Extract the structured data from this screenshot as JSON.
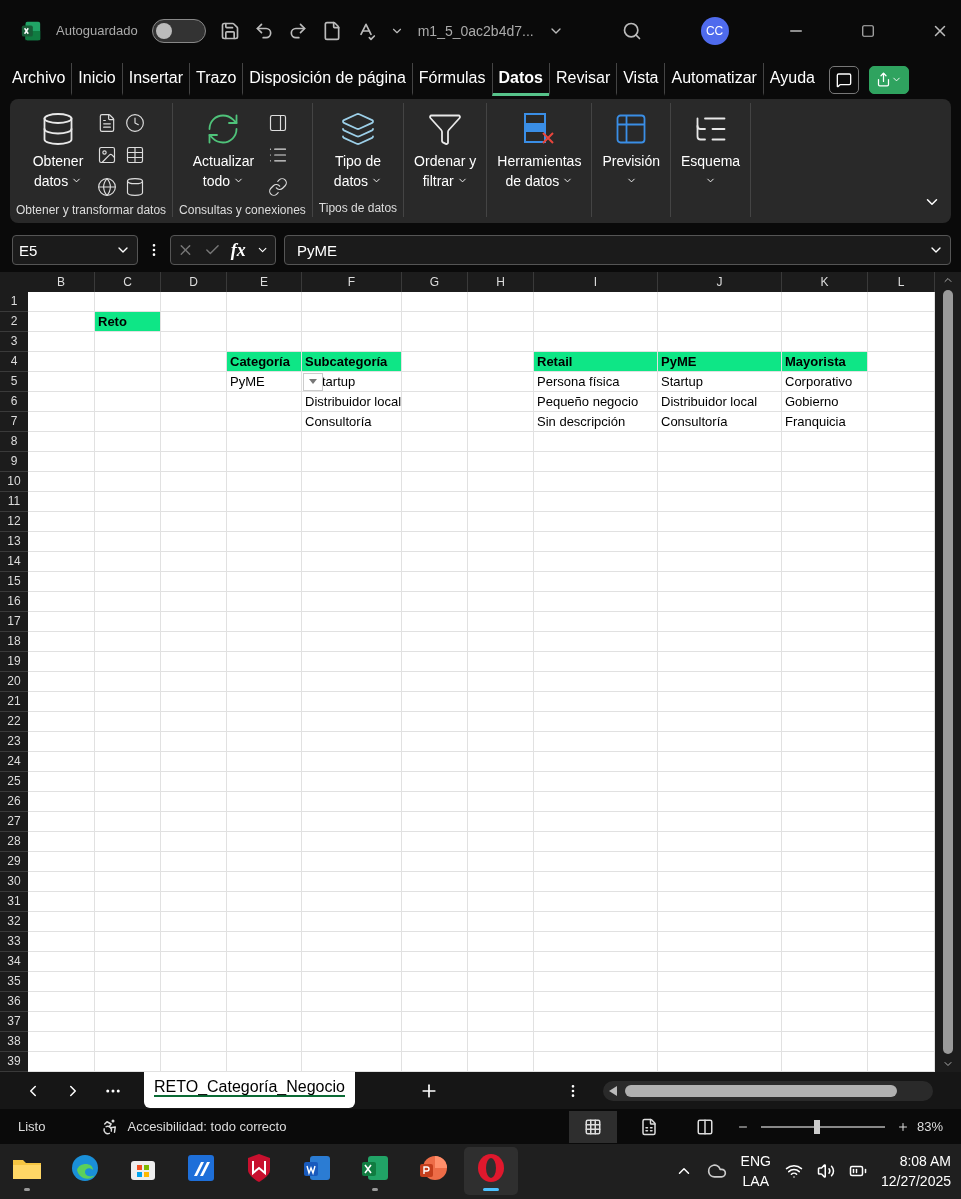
{
  "title_bar": {
    "autosave_label": "Autoguardado",
    "autosave_on": false,
    "file_name": "m1_5_0ac2b4d7...",
    "avatar": "CC"
  },
  "menu_tabs": [
    {
      "label": "Archivo",
      "selected": false
    },
    {
      "label": "Inicio",
      "selected": false
    },
    {
      "label": "Insertar",
      "selected": false
    },
    {
      "label": "Trazo",
      "selected": false
    },
    {
      "label": "Disposición de página",
      "selected": false
    },
    {
      "label": "Fórmulas",
      "selected": false
    },
    {
      "label": "Datos",
      "selected": true
    },
    {
      "label": "Revisar",
      "selected": false
    },
    {
      "label": "Vista",
      "selected": false
    },
    {
      "label": "Automatizar",
      "selected": false
    },
    {
      "label": "Ayuda",
      "selected": false
    }
  ],
  "ribbon": {
    "groups": [
      {
        "label": "Obtener y transformar datos",
        "button": {
          "lines": [
            "Obtener",
            "datos"
          ]
        }
      },
      {
        "label": "Consultas y conexiones",
        "button": {
          "lines": [
            "Actualizar",
            "todo"
          ]
        }
      },
      {
        "label": "Tipos de datos",
        "button": {
          "lines": [
            "Tipo de",
            "datos"
          ]
        }
      },
      {
        "button": {
          "lines": [
            "Ordenar y",
            "filtrar"
          ]
        }
      },
      {
        "button": {
          "lines": [
            "Herramientas",
            "de datos"
          ]
        }
      },
      {
        "button": {
          "lines": [
            "Previsión"
          ]
        }
      },
      {
        "button": {
          "lines": [
            "Esquema"
          ]
        }
      }
    ]
  },
  "formula_bar": {
    "name_box": "E5",
    "function_label": "fx",
    "value": "PyME"
  },
  "sheet": {
    "columns": [
      "B",
      "C",
      "D",
      "E",
      "F",
      "G",
      "H",
      "I",
      "J",
      "K",
      "L"
    ],
    "row_numbers": [
      "1",
      "2",
      "3",
      "4",
      "5",
      "6",
      "7",
      "8",
      "9",
      "10",
      "11",
      "12",
      "13",
      "14",
      "15",
      "16",
      "17",
      "18",
      "19",
      "20",
      "21",
      "22",
      "23",
      "24",
      "25",
      "26",
      "27",
      "28",
      "29",
      "30",
      "31",
      "32",
      "33",
      "34",
      "35",
      "36",
      "37",
      "38",
      "39"
    ],
    "title_cell": "Reto",
    "category_table": {
      "headers": [
        "Categoría",
        "Subcategoría"
      ],
      "category": "PyME",
      "dropdown": true,
      "subcategories": [
        "tartup",
        "Distribuidor local",
        "Consultoría"
      ]
    },
    "lookup_table": {
      "headers": [
        "Retail",
        "PyME",
        "Mayorista"
      ],
      "rows": [
        [
          "Persona física",
          "Startup",
          "Corporativo"
        ],
        [
          "Pequeño negocio",
          "Distribuidor local",
          "Gobierno"
        ],
        [
          "Sin descripción",
          "Consultoría",
          "Franquicia"
        ]
      ]
    }
  },
  "sheet_tabs": [
    {
      "label": "RETO_Categoría_Negocio",
      "selected": true
    }
  ],
  "status_bar": {
    "status": "Listo",
    "accessibility": "Accesibilidad: todo correcto",
    "views": [
      {
        "kind": "normal",
        "selected": true
      },
      {
        "kind": "page-layout",
        "selected": false
      },
      {
        "kind": "page-break",
        "selected": false
      }
    ],
    "zoom": {
      "level": 0.45,
      "reading": "83%"
    }
  },
  "taskbar": {
    "apps": [
      {
        "kind": "folder",
        "open": true,
        "active": false
      },
      {
        "kind": "edge",
        "open": false,
        "active": false
      },
      {
        "kind": "store",
        "open": false,
        "active": false
      },
      {
        "kind": "app",
        "open": false,
        "active": false
      },
      {
        "kind": "shield",
        "open": false,
        "active": false
      },
      {
        "kind": "word",
        "open": false,
        "active": false
      },
      {
        "kind": "excel",
        "open": true,
        "active": false
      },
      {
        "kind": "powerpoint",
        "open": false,
        "active": false
      },
      {
        "kind": "opera",
        "open": true,
        "active": true
      }
    ],
    "language": [
      "ENG",
      "LAA"
    ],
    "time": "8:08 AM",
    "date": "12/27/2025"
  }
}
